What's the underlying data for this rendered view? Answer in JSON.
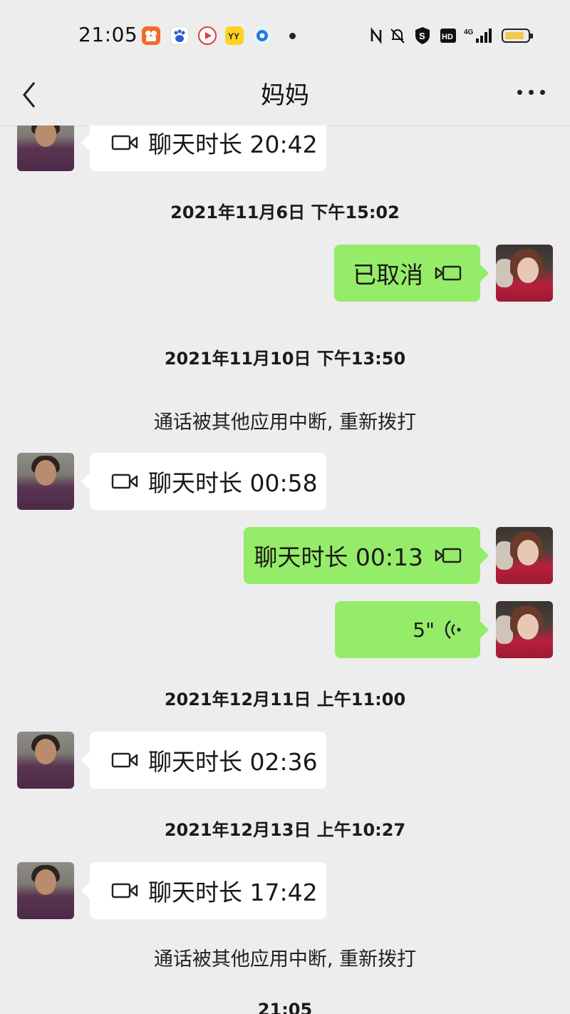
{
  "status_bar": {
    "time": "21:05",
    "app_icons": [
      "kuaishou-icon",
      "baidu-icon",
      "video-app-icon",
      "yy-icon",
      "browser-icon"
    ],
    "app_labels": {
      "yy": "YY"
    },
    "system": {
      "hd": "HD",
      "signal": "4G"
    }
  },
  "nav": {
    "title": "妈妈"
  },
  "messages": [
    {
      "side": "left",
      "type": "video_call",
      "text": "聊天时长 20:42"
    },
    {
      "type": "timestamp",
      "text": "2021年11月6日 下午15:02"
    },
    {
      "side": "right",
      "type": "video_call",
      "text": "已取消"
    },
    {
      "type": "timestamp",
      "text": "2021年11月10日 下午13:50"
    },
    {
      "type": "system",
      "text": "通话被其他应用中断, 重新拨打"
    },
    {
      "side": "left",
      "type": "video_call",
      "text": "聊天时长 00:58"
    },
    {
      "side": "right",
      "type": "video_call",
      "text": "聊天时长 00:13"
    },
    {
      "side": "right",
      "type": "voice",
      "text": "5\""
    },
    {
      "type": "timestamp",
      "text": "2021年12月11日 上午11:00"
    },
    {
      "side": "left",
      "type": "video_call",
      "text": "聊天时长 02:36"
    },
    {
      "type": "timestamp",
      "text": "2021年12月13日 上午10:27"
    },
    {
      "side": "left",
      "type": "video_call",
      "text": "聊天时长 17:42"
    },
    {
      "type": "system",
      "text": "通话被其他应用中断, 重新拨打"
    },
    {
      "type": "timestamp",
      "text": "21:05"
    }
  ],
  "colors": {
    "background": "#ededed",
    "bubble_mine": "#95ec69",
    "bubble_other": "#ffffff"
  }
}
